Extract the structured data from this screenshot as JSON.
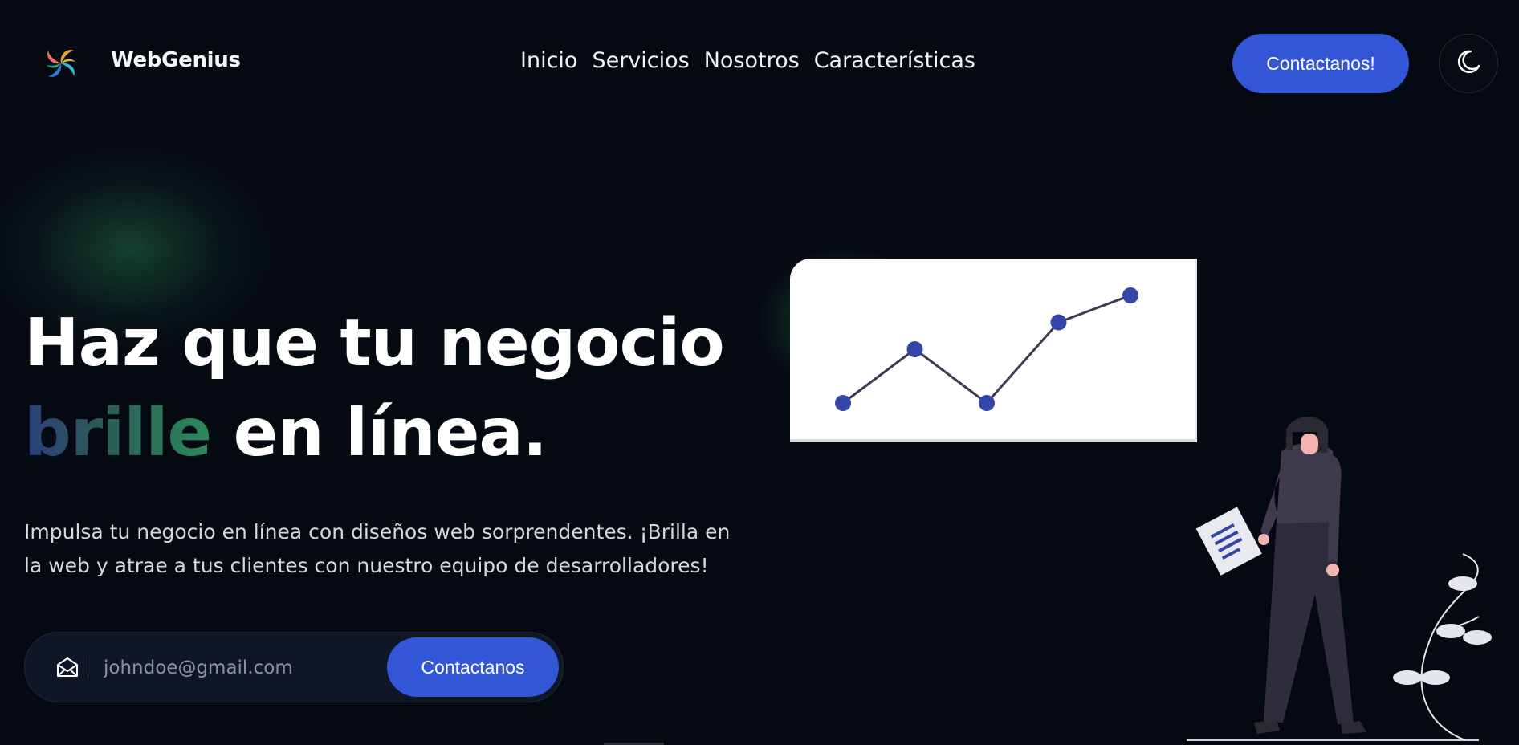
{
  "brand": {
    "name": "WebGenius",
    "logo_icon": "pinwheel-logo-icon"
  },
  "nav": {
    "items": [
      {
        "label": "Inicio"
      },
      {
        "label": "Servicios"
      },
      {
        "label": "Nosotros"
      },
      {
        "label": "Características"
      }
    ]
  },
  "header": {
    "cta_label": "Contactanos!",
    "theme_toggle_icon": "moon-icon"
  },
  "hero": {
    "title_line1": "Haz que tu negocio",
    "title_highlight": "brille",
    "title_line2_rest": " en línea.",
    "description": "Impulsa tu negocio en línea con diseños web sorprendentes. ¡Brilla en la web y atrae a tus clientes con nuestro equipo de desarrolladores!",
    "email_placeholder": "johndoe@gmail.com",
    "email_icon": "envelope-open-icon",
    "submit_label": "Contactanos"
  },
  "illustration": {
    "chart_points": [
      {
        "x": 1,
        "y": 1
      },
      {
        "x": 2,
        "y": 3
      },
      {
        "x": 3,
        "y": 1
      },
      {
        "x": 4,
        "y": 4
      },
      {
        "x": 5,
        "y": 5
      }
    ]
  },
  "colors": {
    "background": "#050912",
    "accent": "#3356d6",
    "chart_point": "#3346a8",
    "chart_line": "#3d3b52",
    "glow": "#2ec46e"
  }
}
